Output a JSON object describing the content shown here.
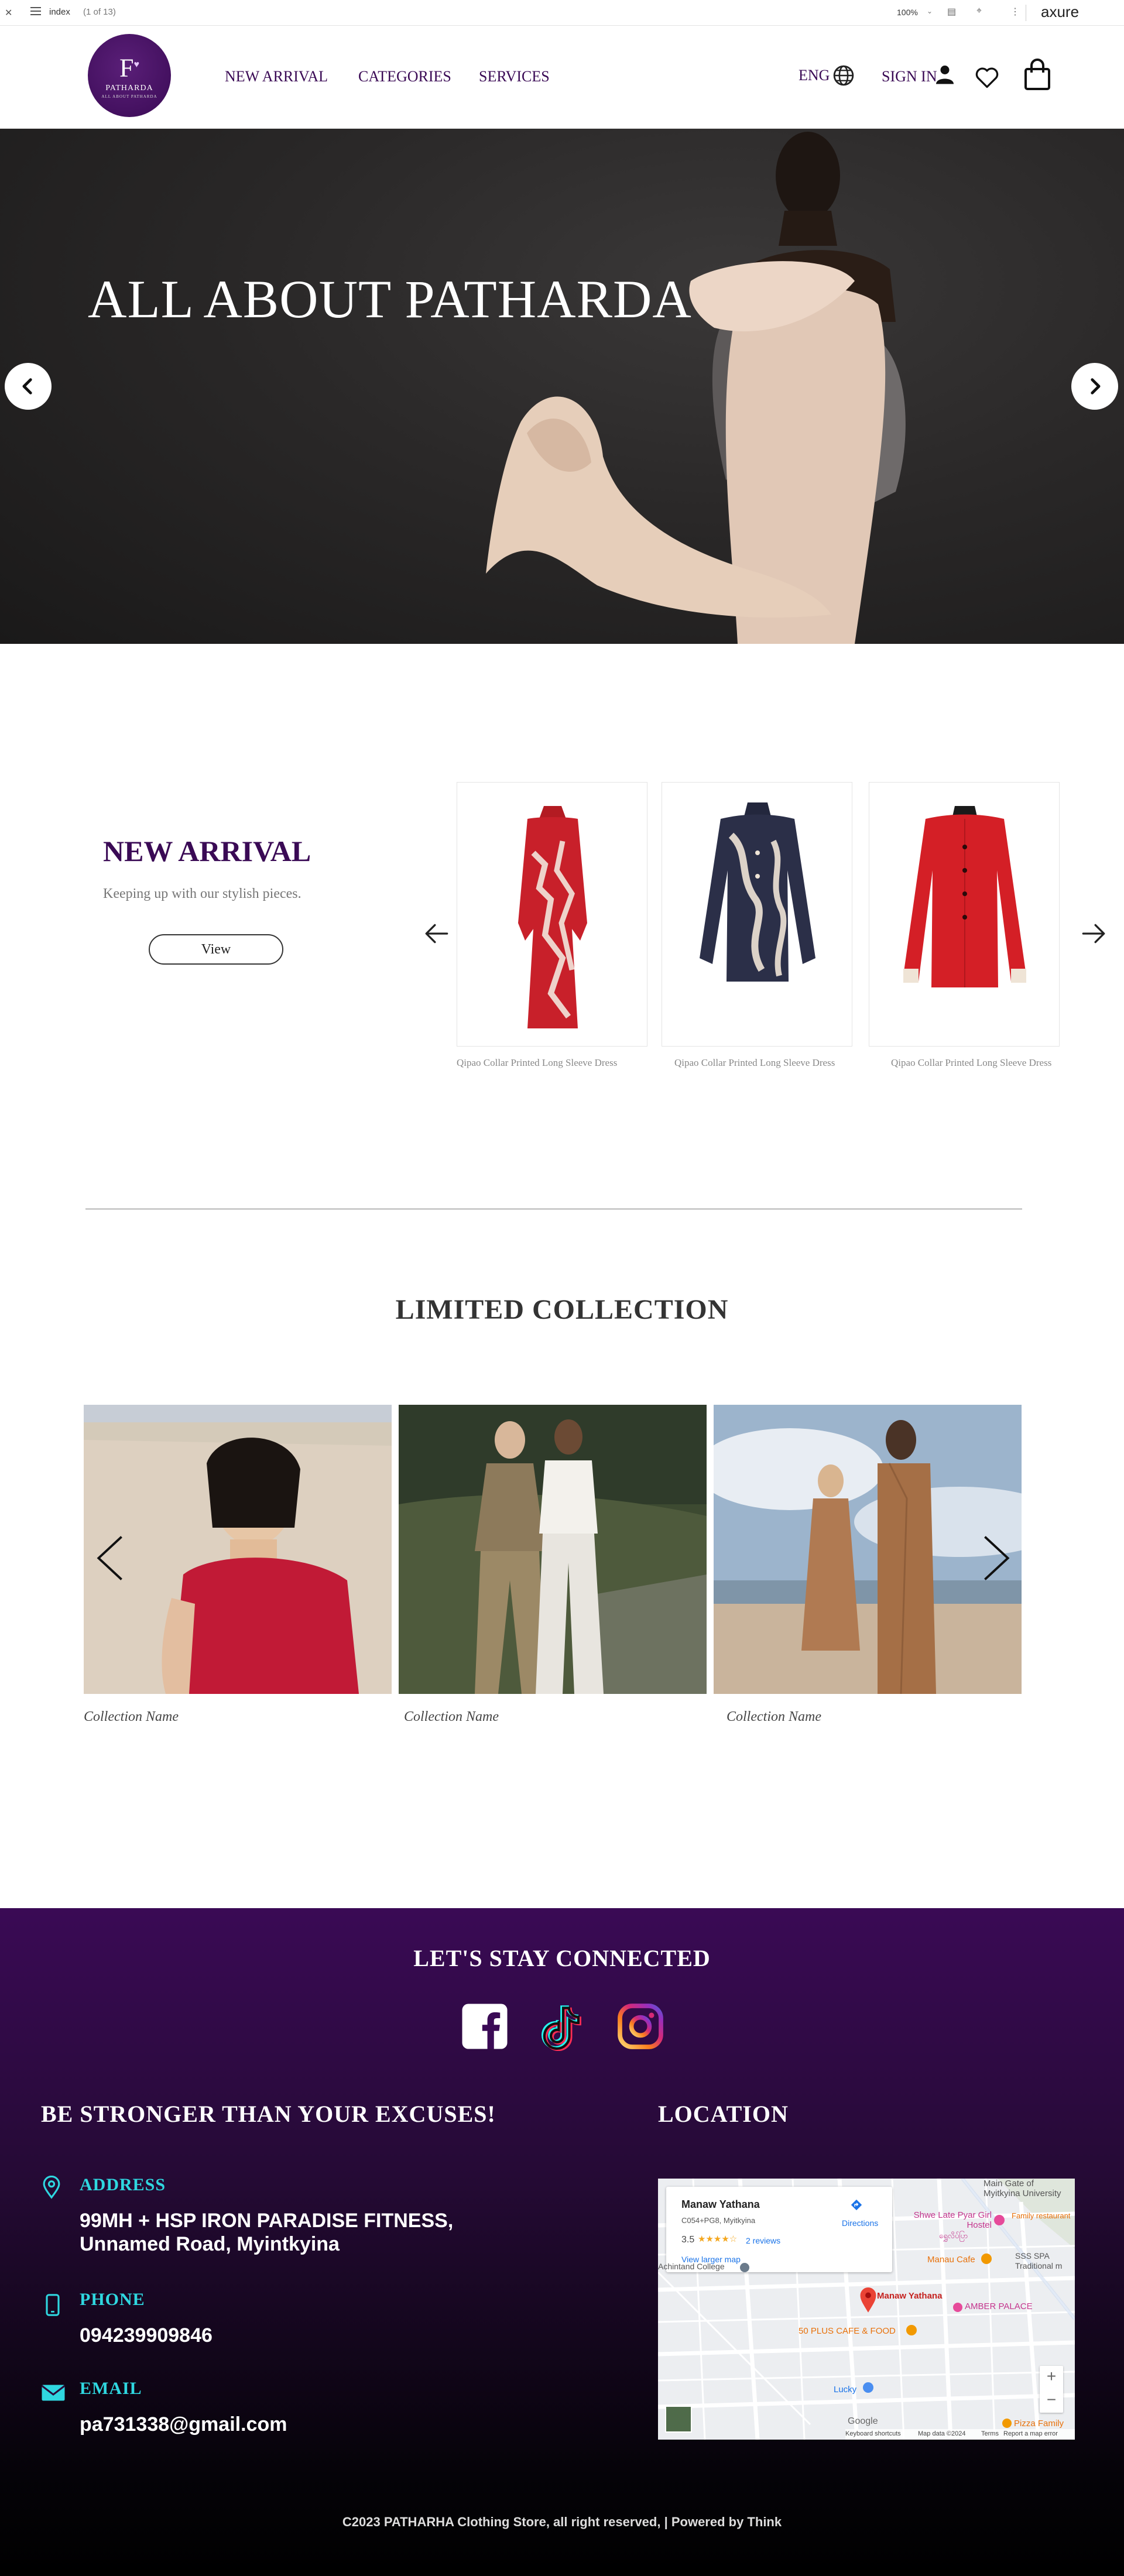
{
  "axure": {
    "page_name": "index",
    "page_count": "(1 of 13)",
    "zoom": "100%",
    "logo": "axure"
  },
  "header": {
    "brand": {
      "monogram": "F",
      "name": "PATHARDA",
      "tagline": "ALL ABOUT PATHARDA"
    },
    "nav": [
      "NEW ARRIVAL",
      "CATEGORIES",
      "SERVICES"
    ],
    "language": "ENG",
    "signin": "SIGN IN"
  },
  "hero": {
    "title": "ALL ABOUT PATHARDA"
  },
  "new_arrival": {
    "title": "NEW ARRIVAL",
    "subtitle": "Keeping up with our stylish pieces.",
    "button": "View",
    "products": [
      {
        "name": "Qipao Collar Printed Long Sleeve Dress",
        "color": "#c8202a"
      },
      {
        "name": "Qipao Collar Printed Long Sleeve Dress",
        "color": "#2b2f48"
      },
      {
        "name": "Qipao Collar Printed Long Sleeve Dress",
        "color": "#d41f26"
      }
    ]
  },
  "limited_collection": {
    "title": "LIMITED COLLECTION",
    "items": [
      {
        "name": "Collection Name"
      },
      {
        "name": "Collection Name"
      },
      {
        "name": "Collection Name"
      }
    ]
  },
  "footer": {
    "connect_title": "LET'S STAY CONNECTED",
    "social": [
      "facebook",
      "tiktok",
      "instagram"
    ],
    "motto": "BE STRONGER THAN YOUR EXCUSES!",
    "location_title": "LOCATION",
    "address_label": "ADDRESS",
    "address_line1": "99MH + HSP IRON PARADISE FITNESS,",
    "address_line2": "Unnamed Road, Myintkyina",
    "phone_label": "PHONE",
    "phone": "094239909846",
    "email_label": "EMAIL",
    "email": "pa731338@gmail.com",
    "copyright": "C2023 PATHARHA Clothing Store, all right reserved, | Powered by Think",
    "map": {
      "place": "Manaw Yathana",
      "code": "C054+PG8, Myitkyina",
      "rating": "3.5",
      "reviews": "2 reviews",
      "directions": "Directions",
      "larger": "View larger map",
      "labels": {
        "university": "Main Gate of Myitkyina University",
        "hostel": "Shwe Late Pyar Girl Hostel",
        "hostel_sub": "ရွှေလိပ်ပြာ",
        "family": "Family restaurant",
        "cafe1": "Manau Cafe",
        "sss": "SSS SPA Traditional m",
        "college": "Achintand College",
        "pin": "Manaw Yathana",
        "amber": "AMBER PALACE",
        "fifty": "50 PLUS CAFE & FOOD",
        "lucky": "Lucky",
        "pizza": "Pizza Family",
        "google": "Google",
        "shortcuts": "Keyboard shortcuts",
        "mapdata": "Map data ©2024",
        "terms": "Terms",
        "report": "Report a map error"
      }
    }
  }
}
